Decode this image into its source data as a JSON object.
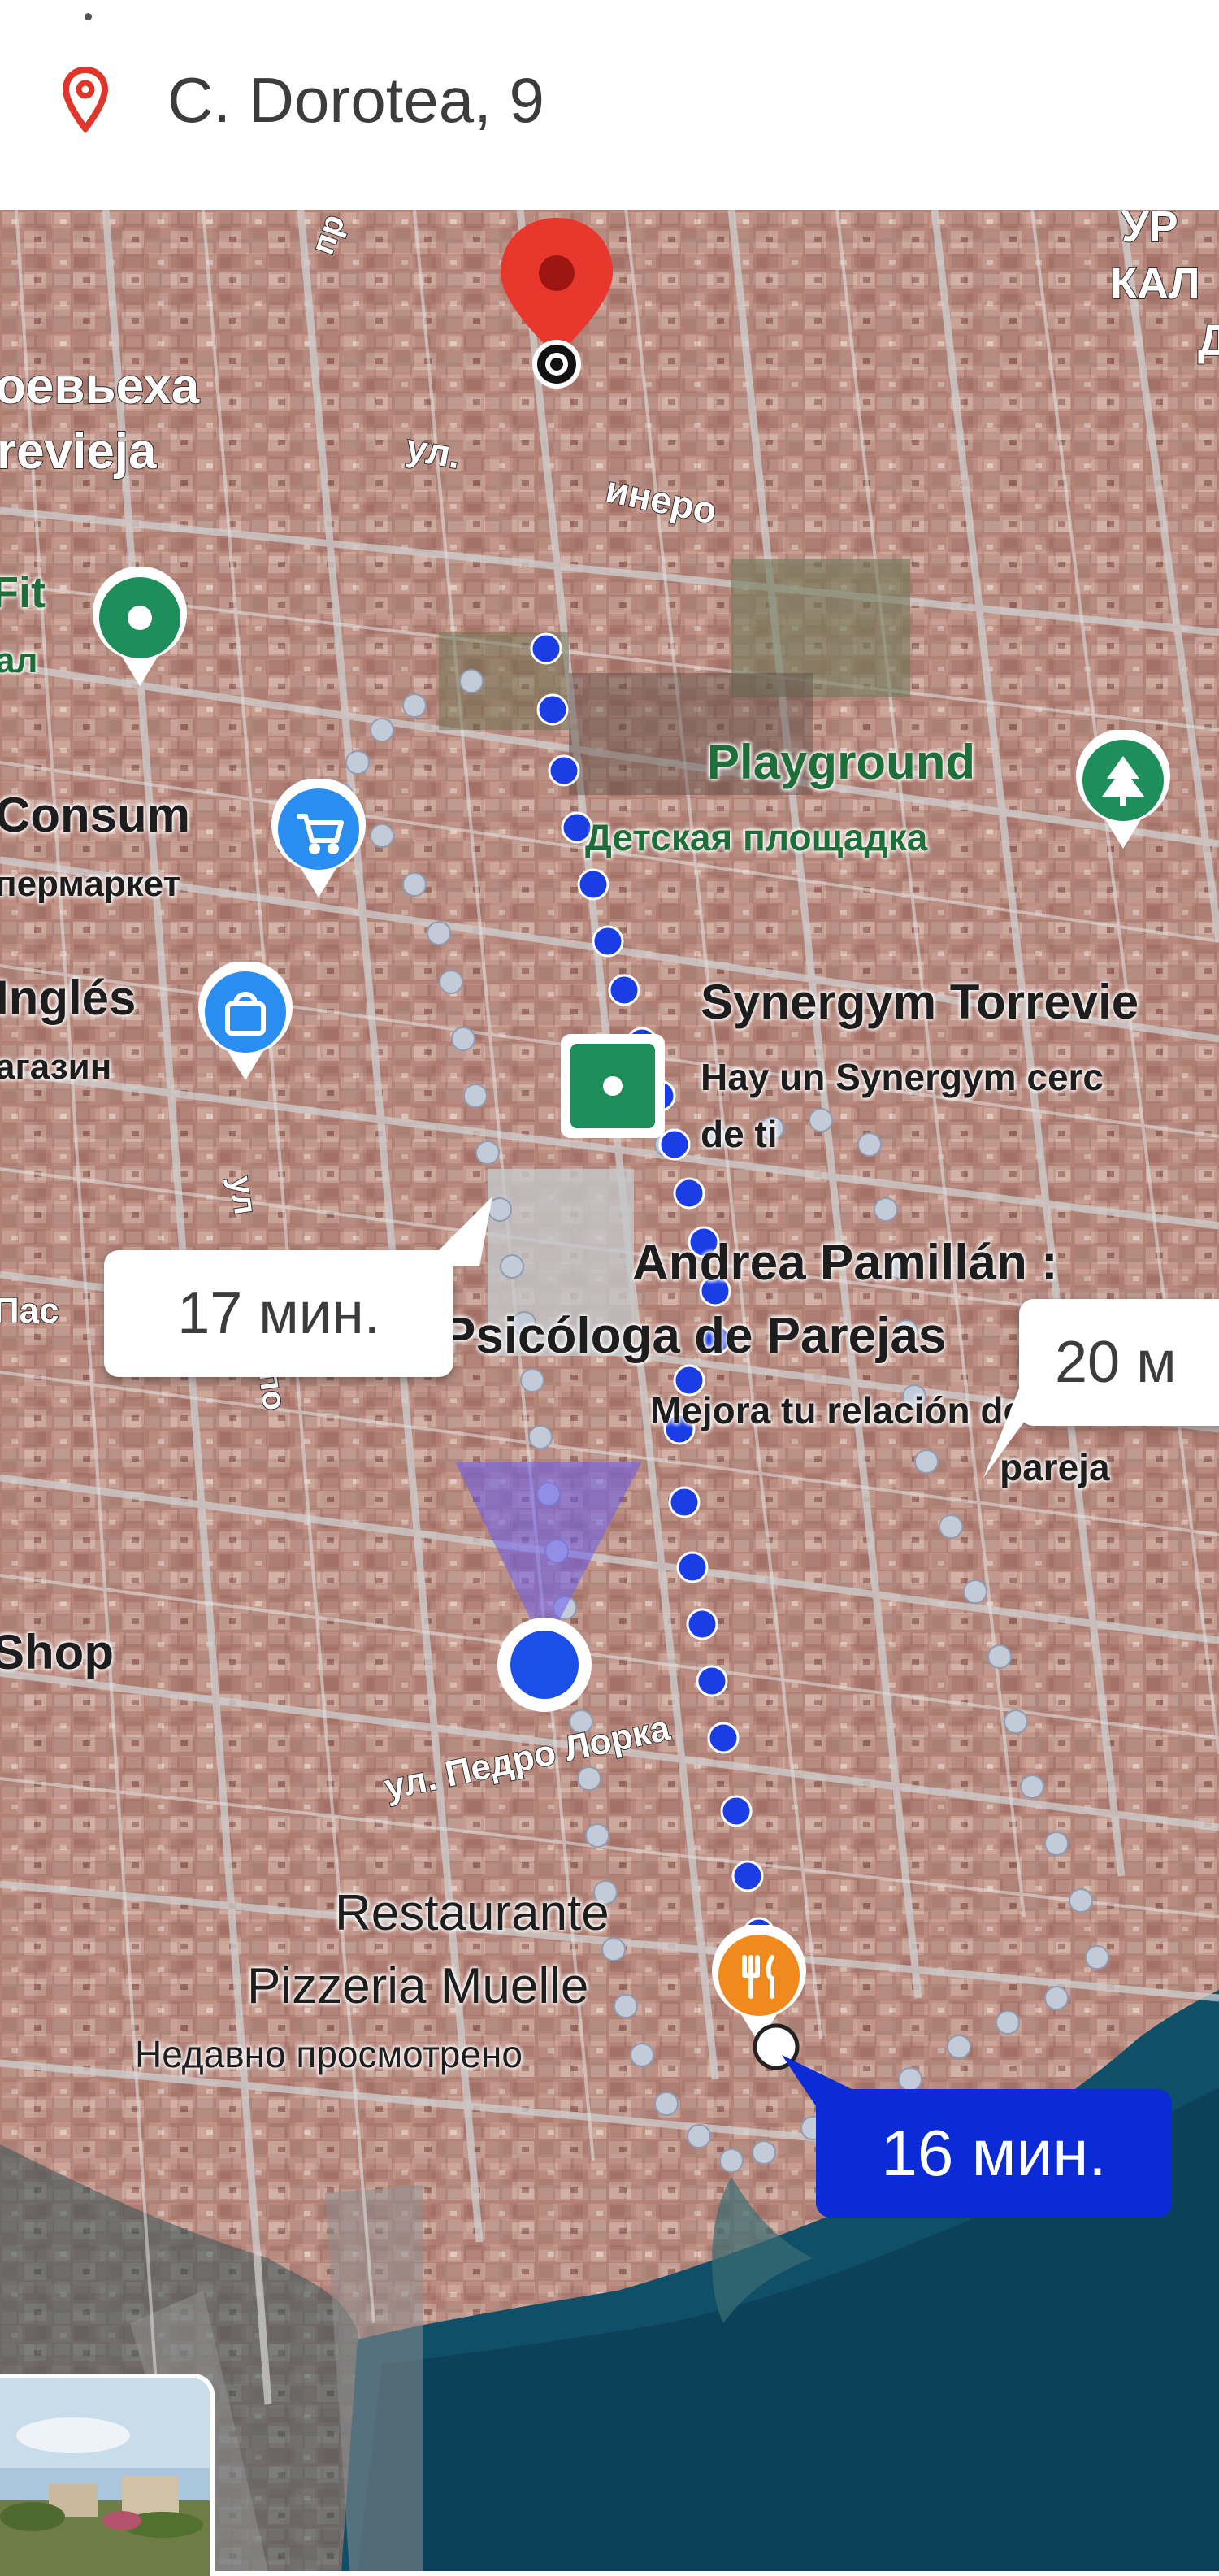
{
  "header": {
    "address": "C. Dorotea, 9",
    "pin_color": "#e0352b"
  },
  "map": {
    "type": "satellite",
    "route_color": "#1a3de6",
    "alt_route_color": "#b8c4d9",
    "street_labels": {
      "minero_left": "ул.",
      "minero_right": "инеро",
      "pedro_lorca": "ул. Педро Лорка",
      "vertical_u": "ул",
      "vertical_po": "по",
      "top_pr": "пр"
    },
    "area_labels": {
      "torrevieja_ru": "оевьеха",
      "torrevieja": "revieja",
      "top_right_1": "УР",
      "top_right_2": "КАЛ",
      "top_right_3": "Д",
      "pas": "Пас"
    },
    "pois": [
      {
        "id": "fit",
        "name": "Fit",
        "sub": "ал",
        "icon": "pin-icon",
        "color": "#1e8f5a"
      },
      {
        "id": "consum",
        "name": "Consum",
        "sub": "пермаркет",
        "icon": "shopping-cart-icon",
        "color": "#2a8ef0"
      },
      {
        "id": "ingles",
        "name": "Inglés",
        "sub": "агазин",
        "icon": "shopping-bag-icon",
        "color": "#2a8ef0"
      },
      {
        "id": "playground",
        "name": "Playground",
        "sub": "Детская площадка",
        "icon": "tree-icon",
        "color": "#1e8f5a"
      },
      {
        "id": "synergym",
        "name": "Synergym Torrevie",
        "sub1": "Hay un Synergym cerc",
        "sub2": "de ti",
        "icon": "square-dot-icon",
        "color": "#1e8f5a"
      },
      {
        "id": "andrea",
        "name1": "Andrea Pamillán :",
        "name2": "Psicóloga de Parejas",
        "sub1": "Mejora tu relación de",
        "sub2": "pareja"
      },
      {
        "id": "shop",
        "name": "Shop"
      },
      {
        "id": "restaurant",
        "name1": "Restaurante",
        "name2": "Pizzeria Muelle",
        "sub": "Недавно просмотрено",
        "icon": "fork-knife-icon",
        "color": "#f08a1c"
      }
    ],
    "route_bubbles": {
      "left": "17 мин.",
      "right": "20 м",
      "selected": "16 мин."
    }
  }
}
